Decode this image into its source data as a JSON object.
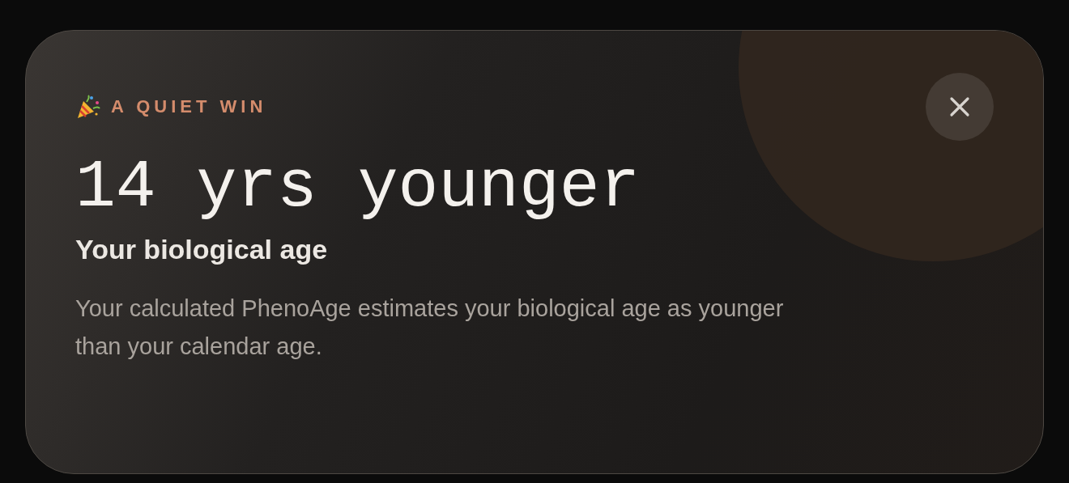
{
  "card": {
    "eyebrow": "A QUIET WIN",
    "headline": "14 yrs younger",
    "subtitle": "Your biological age",
    "body": "Your calculated PhenoAge estimates your biological age as younger than your calendar age."
  }
}
